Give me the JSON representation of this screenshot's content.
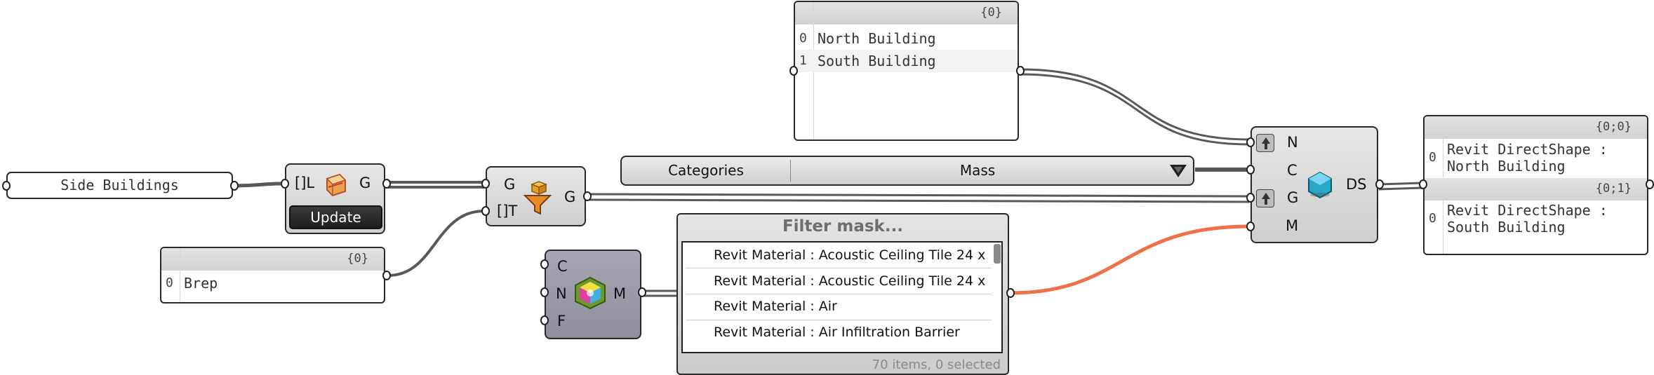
{
  "colors": {
    "wire": "#595959",
    "wire_highlight": "#f0704a",
    "node_fill": "#dcdcdc",
    "dark_node_fill": "#9a9aa8"
  },
  "text_panel": {
    "value": "Side Buildings"
  },
  "layer_component": {
    "input_label": "[]L",
    "output_label": "G",
    "icon": "layer-cube-icon",
    "button_label": "Update"
  },
  "brep_panel": {
    "path": "{0}",
    "index": "0",
    "value": "Brep"
  },
  "filter_component": {
    "input_g": "G",
    "input_t": "[]T",
    "output": "G",
    "icon": "funnel-filter-icon"
  },
  "names_panel": {
    "path": "{0}",
    "items": [
      {
        "index": "0",
        "value": "North Building"
      },
      {
        "index": "1",
        "value": "South Building"
      }
    ]
  },
  "categories_dropdown": {
    "label": "Categories",
    "value": "Mass",
    "icon": "dropdown-arrow-icon"
  },
  "material_component": {
    "inputs": [
      "C",
      "N",
      "F"
    ],
    "output": "M",
    "icon": "material-cube-icon"
  },
  "filter_mask": {
    "title": "Filter mask...",
    "items": [
      "Revit Material : Acoustic Ceiling Tile 24 x",
      "Revit Material : Acoustic Ceiling Tile 24 x",
      "Revit Material : Air",
      "Revit Material : Air Infiltration Barrier"
    ],
    "footer": "70 items, 0 selected"
  },
  "directshape_component": {
    "inputs": [
      "N",
      "C",
      "G",
      "M"
    ],
    "output": "DS",
    "icon": "directshape-hexagon-icon"
  },
  "output_panel": {
    "groups": [
      {
        "path": "{0;0}",
        "index": "0",
        "line1": "Revit DirectShape :",
        "line2": "North Building"
      },
      {
        "path": "{0;1}",
        "index": "0",
        "line1": "Revit DirectShape :",
        "line2": "South Building"
      }
    ]
  }
}
